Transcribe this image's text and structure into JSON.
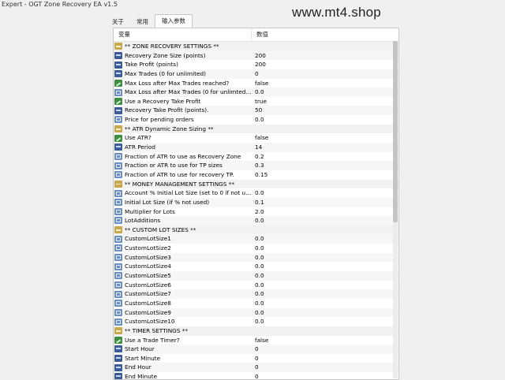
{
  "window": {
    "title": "Expert - OGT Zone Recovery EA v1.5"
  },
  "watermark": "www.mt4.shop",
  "tabs": [
    {
      "label": "关于",
      "active": false
    },
    {
      "label": "常用",
      "active": false
    },
    {
      "label": "输入参数",
      "active": true
    }
  ],
  "table": {
    "headers": {
      "variable": "变量",
      "value": "数值"
    },
    "rows": [
      {
        "icon": "section",
        "name": "** ZONE RECOVERY SETTINGS **",
        "value": ""
      },
      {
        "icon": "number",
        "name": "Recovery Zone Size (points)",
        "value": "200"
      },
      {
        "icon": "number",
        "name": "Take Profit (points)",
        "value": "200"
      },
      {
        "icon": "number",
        "name": "Max Trades (0 for unlimited)",
        "value": "0"
      },
      {
        "icon": "bool",
        "name": "Max Loss after Max Trades reached?",
        "value": "false"
      },
      {
        "icon": "double",
        "name": "Max Loss after Max Trades (0 for unlimted) in d...",
        "value": "0.0"
      },
      {
        "icon": "bool",
        "name": "Use a Recovery Take Profit",
        "value": "true"
      },
      {
        "icon": "number",
        "name": "Recovery Take Profit (points).",
        "value": "50"
      },
      {
        "icon": "double",
        "name": "Price for pending orders",
        "value": "0.0"
      },
      {
        "icon": "section",
        "name": "** ATR Dynamic Zone Sizing **",
        "value": ""
      },
      {
        "icon": "bool",
        "name": "Use ATR?",
        "value": "false"
      },
      {
        "icon": "number",
        "name": "ATR Period",
        "value": "14"
      },
      {
        "icon": "double",
        "name": "Fraction of ATR to use as Recovery Zone",
        "value": "0.2"
      },
      {
        "icon": "double",
        "name": "Fraction or ATR to use for TP sizes",
        "value": "0.3"
      },
      {
        "icon": "double",
        "name": "Fraction of ATR to use for recovery TP.",
        "value": "0.15"
      },
      {
        "icon": "section",
        "name": "** MONEY MANAGEMENT SETTINGS **",
        "value": ""
      },
      {
        "icon": "double",
        "name": "Account % Initial Lot Size  (set to 0 if not used)",
        "value": "0.0"
      },
      {
        "icon": "double",
        "name": "Initial Lot Size (if % not used)",
        "value": "0.1"
      },
      {
        "icon": "double",
        "name": "Multiplier for Lots",
        "value": "2.0"
      },
      {
        "icon": "double",
        "name": "LotAdditions",
        "value": "0.0"
      },
      {
        "icon": "section",
        "name": "** CUSTOM LOT SIZES **",
        "value": ""
      },
      {
        "icon": "double",
        "name": "CustomLotSize1",
        "value": "0.0"
      },
      {
        "icon": "double",
        "name": "CustomLotSize2",
        "value": "0.0"
      },
      {
        "icon": "double",
        "name": "CustomLotSize3",
        "value": "0.0"
      },
      {
        "icon": "double",
        "name": "CustomLotSize4",
        "value": "0.0"
      },
      {
        "icon": "double",
        "name": "CustomLotSize5",
        "value": "0.0"
      },
      {
        "icon": "double",
        "name": "CustomLotSize6",
        "value": "0.0"
      },
      {
        "icon": "double",
        "name": "CustomLotSize7",
        "value": "0.0"
      },
      {
        "icon": "double",
        "name": "CustomLotSize8",
        "value": "0.0"
      },
      {
        "icon": "double",
        "name": "CustomLotSize9",
        "value": "0.0"
      },
      {
        "icon": "double",
        "name": "CustomLotSize10",
        "value": "0.0"
      },
      {
        "icon": "section",
        "name": "** TIMER SETTINGS **",
        "value": ""
      },
      {
        "icon": "bool",
        "name": "Use a Trade Timer?",
        "value": "false"
      },
      {
        "icon": "number",
        "name": "Start Hour",
        "value": "0"
      },
      {
        "icon": "number",
        "name": "Start Minute",
        "value": "0"
      },
      {
        "icon": "number",
        "name": "End Hour",
        "value": "0"
      },
      {
        "icon": "number",
        "name": "End Minute",
        "value": "0"
      }
    ]
  }
}
